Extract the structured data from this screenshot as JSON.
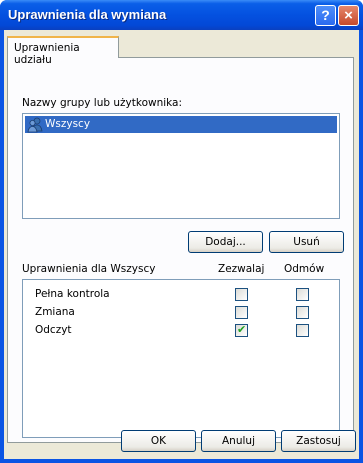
{
  "window": {
    "title": "Uprawnienia dla wymiana"
  },
  "titlebar_buttons": {
    "help": "?",
    "close": "×"
  },
  "tabs": [
    {
      "label": "Uprawnienia udziału"
    }
  ],
  "groups": {
    "label": "Nazwy grupy lub użytkownika:",
    "items": [
      {
        "name": "Wszyscy",
        "icon": "users-group-icon",
        "selected": true
      }
    ],
    "add_button": "Dodaj...",
    "remove_button": "Usuń"
  },
  "permissions": {
    "header": "Uprawnienia dla Wszyscy",
    "allow_header": "Zezwalaj",
    "deny_header": "Odmów",
    "rows": [
      {
        "name": "Pełna kontrola",
        "allow": false,
        "deny": false
      },
      {
        "name": "Zmiana",
        "allow": false,
        "deny": false
      },
      {
        "name": "Odczyt",
        "allow": true,
        "deny": false
      }
    ]
  },
  "footer": {
    "ok": "OK",
    "cancel": "Anuluj",
    "apply": "Zastosuj"
  },
  "colors": {
    "titlebar": "#0451e0",
    "selection": "#316ac5",
    "dialog_bg": "#ece9d8",
    "check": "#21a121"
  }
}
